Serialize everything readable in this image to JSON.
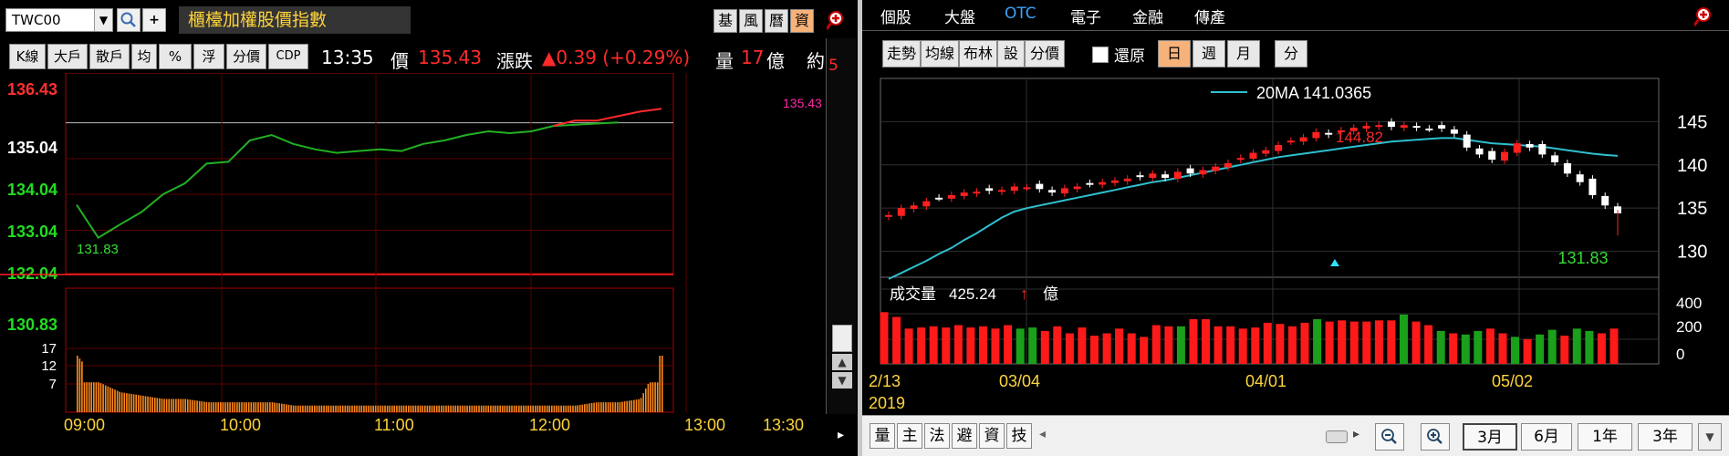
{
  "left": {
    "ticker": "TWC00",
    "index_name": "櫃檯加權股價指數",
    "tools": [
      "基",
      "風",
      "曆",
      "資"
    ],
    "modes": [
      "K線",
      "大戶",
      "散戶",
      "均",
      "%",
      "浮",
      "分價",
      "CDP"
    ],
    "quote": {
      "time": "13:35",
      "price_label": "價",
      "price": "135.43",
      "change_label": "漲跌",
      "change": "▲0.39 (+0.29%)",
      "volume_label": "量",
      "volume": "17",
      "volume_unit": "億",
      "cut_label": "約"
    },
    "y_labels": [
      {
        "text": "136.43",
        "color": "#ff3030"
      },
      {
        "text": "135.04",
        "color": "#ffffff"
      },
      {
        "text": "134.04",
        "color": "#22dd22"
      },
      {
        "text": "133.04",
        "color": "#22dd22"
      },
      {
        "text": "132.04",
        "color": "#22dd22"
      },
      {
        "text": "130.83",
        "color": "#22dd22"
      }
    ],
    "low_label": "131.83",
    "high_label": "135.43",
    "vol_labels": [
      "17",
      "12",
      "7"
    ],
    "x_labels": [
      "09:00",
      "10:00",
      "11:00",
      "12:00",
      "13:00",
      "13:30"
    ],
    "side_mark": "5"
  },
  "right": {
    "tabs": [
      "個股",
      "大盤",
      "OTC",
      "電子",
      "金融",
      "傳產"
    ],
    "active_tab": "OTC",
    "tools": [
      "走勢",
      "均線",
      "布林",
      "設",
      "分價"
    ],
    "restore_label": "還原",
    "periods": [
      "日",
      "週",
      "月"
    ],
    "minute_label": "分",
    "ma_legend": "20MA 141.0365",
    "high_label": "144.82",
    "low_label": "131.83",
    "price_axis": [
      "145",
      "140",
      "135",
      "130"
    ],
    "volume_label": "成交量",
    "volume_value": "425.24",
    "volume_arrow": "↑",
    "volume_unit": "億",
    "volume_axis": [
      "400",
      "200",
      "0"
    ],
    "x_labels": [
      "2/13",
      "03/04",
      "04/01",
      "05/02"
    ],
    "year_label": "2019",
    "bottom_tabs": [
      "量",
      "主",
      "法",
      "避",
      "資",
      "技"
    ],
    "ranges": [
      "3月",
      "6月",
      "1年",
      "3年"
    ],
    "active_range": "3月"
  },
  "chart_data": [
    {
      "type": "line",
      "title": "櫃檯加權股價指數",
      "xlabel": "",
      "ylabel": "",
      "x": [
        "09:00",
        "09:10",
        "09:20",
        "09:30",
        "09:40",
        "09:50",
        "10:00",
        "10:10",
        "10:20",
        "10:30",
        "10:40",
        "10:50",
        "11:00",
        "11:10",
        "11:20",
        "11:30",
        "11:40",
        "11:50",
        "12:00",
        "12:10",
        "12:20",
        "12:30",
        "12:40",
        "12:50",
        "13:00",
        "13:10",
        "13:20",
        "13:30"
      ],
      "series": [
        {
          "values": [
            132.75,
            131.83,
            132.2,
            132.55,
            133.05,
            133.35,
            133.9,
            133.95,
            134.55,
            134.7,
            134.45,
            134.3,
            134.2,
            134.25,
            134.3,
            134.25,
            134.45,
            134.55,
            134.7,
            134.8,
            134.75,
            134.8,
            134.95,
            135.1,
            135.1,
            135.05,
            135.35,
            135.43
          ]
        }
      ],
      "ylim": [
        130.83,
        136.43
      ],
      "reference_price": 135.04,
      "volume": [
        17,
        9,
        6,
        5,
        4,
        4,
        3,
        3,
        3,
        3,
        2,
        2,
        2,
        2,
        2,
        2,
        2,
        2,
        2,
        2,
        2,
        2,
        2,
        2,
        3,
        3,
        4,
        17
      ],
      "volume_ylim": [
        0,
        17
      ]
    },
    {
      "type": "candlestick",
      "title": "OTC",
      "x": [
        "2/13",
        "2/14",
        "2/15",
        "2/18",
        "2/19",
        "2/20",
        "2/21",
        "2/22",
        "2/25",
        "2/26",
        "2/27",
        "3/04",
        "3/05",
        "3/06",
        "3/07",
        "3/08",
        "3/11",
        "3/12",
        "3/13",
        "3/14",
        "3/15",
        "3/18",
        "3/19",
        "3/20",
        "3/21",
        "3/22",
        "3/25",
        "3/26",
        "3/27",
        "3/28",
        "3/29",
        "4/01",
        "4/02",
        "4/03",
        "4/08",
        "4/09",
        "4/10",
        "4/11",
        "4/12",
        "4/15",
        "4/16",
        "4/17",
        "4/18",
        "4/19",
        "4/22",
        "4/23",
        "4/24",
        "4/25",
        "4/26",
        "4/29",
        "4/30",
        "5/02",
        "5/03",
        "5/06",
        "5/07",
        "5/08",
        "5/09",
        "5/10",
        "5/13"
      ],
      "close": [
        134.2,
        135.0,
        135.3,
        135.8,
        136.2,
        136.5,
        136.8,
        136.9,
        137.0,
        137.1,
        137.5,
        137.4,
        137.2,
        136.8,
        137.3,
        137.5,
        137.8,
        138.0,
        138.2,
        138.4,
        138.6,
        139.0,
        138.5,
        139.2,
        139.0,
        139.4,
        139.8,
        140.2,
        140.8,
        141.4,
        141.7,
        142.3,
        142.8,
        143.2,
        143.8,
        143.5,
        144.0,
        144.3,
        144.5,
        144.6,
        144.4,
        144.6,
        144.3,
        144.2,
        144.2,
        143.6,
        142.0,
        141.2,
        140.6,
        141.5,
        142.5,
        142.0,
        141.2,
        140.3,
        139.0,
        138.0,
        136.5,
        135.3,
        134.4
      ],
      "ma_20": [
        126.8,
        127.5,
        128.2,
        128.9,
        129.7,
        130.4,
        131.3,
        132.1,
        133.0,
        133.9,
        134.6,
        135.0,
        135.3,
        135.6,
        135.9,
        136.2,
        136.5,
        136.8,
        137.1,
        137.4,
        137.7,
        138.0,
        138.2,
        138.5,
        138.8,
        139.1,
        139.4,
        139.7,
        140.0,
        140.3,
        140.6,
        140.9,
        141.1,
        141.3,
        141.5,
        141.7,
        141.9,
        142.1,
        142.3,
        142.5,
        142.7,
        142.8,
        142.9,
        143.0,
        143.1,
        143.1,
        142.9,
        142.7,
        142.5,
        142.4,
        142.3,
        142.2,
        142.1,
        141.9,
        141.7,
        141.5,
        141.3,
        141.15,
        141.04
      ],
      "ylim": [
        127,
        150
      ],
      "high": 144.82,
      "low": 131.83,
      "volume": [
        440,
        400,
        300,
        310,
        320,
        310,
        330,
        310,
        320,
        300,
        330,
        300,
        310,
        280,
        320,
        260,
        310,
        240,
        260,
        300,
        260,
        230,
        330,
        320,
        320,
        380,
        380,
        320,
        320,
        300,
        310,
        350,
        340,
        320,
        350,
        380,
        360,
        370,
        360,
        360,
        370,
        370,
        420,
        360,
        330,
        280,
        260,
        250,
        280,
        300,
        260,
        230,
        210,
        250,
        290,
        240,
        300,
        280,
        260,
        300
      ],
      "volume_ylim": [
        0,
        520
      ]
    }
  ]
}
